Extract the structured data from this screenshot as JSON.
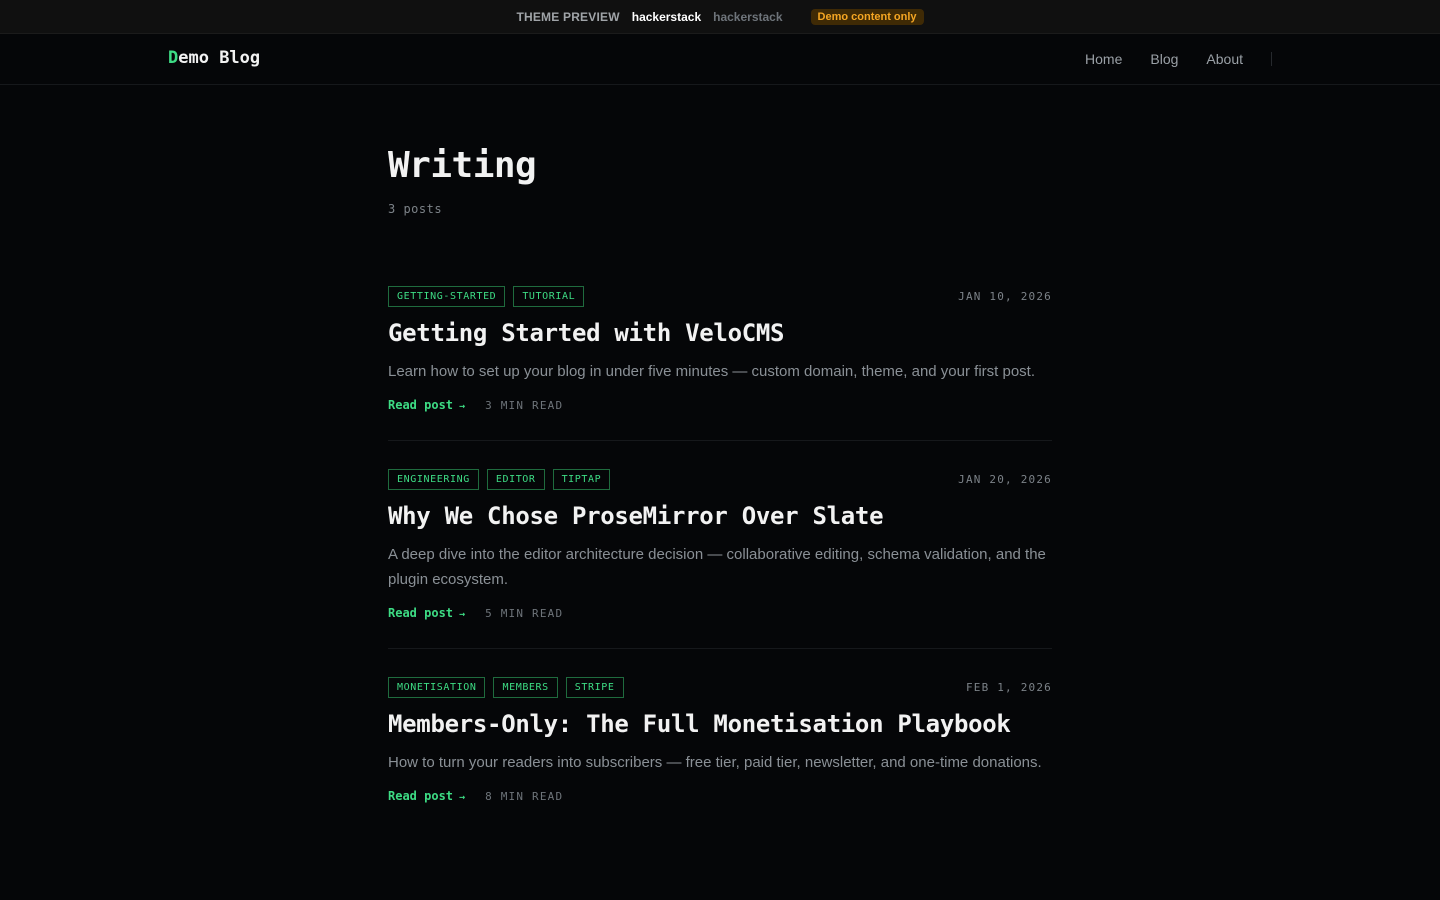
{
  "preview_bar": {
    "label": "THEME PREVIEW",
    "active_theme": "hackerstack",
    "inactive_theme": "hackerstack",
    "badge": "Demo content only"
  },
  "header": {
    "logo_first_letter": "D",
    "logo_rest": "emo Blog",
    "nav": [
      {
        "label": "Home"
      },
      {
        "label": "Blog"
      },
      {
        "label": "About"
      }
    ]
  },
  "page": {
    "title": "Writing",
    "post_count": "3 posts"
  },
  "read_link_label": "Read post",
  "posts": [
    {
      "tags": [
        "GETTING-STARTED",
        "TUTORIAL"
      ],
      "date": "JAN 10, 2026",
      "title": "Getting Started with VeloCMS",
      "excerpt": "Learn how to set up your blog in under five minutes — custom domain, theme, and your first post.",
      "read_time": "3 MIN READ"
    },
    {
      "tags": [
        "ENGINEERING",
        "EDITOR",
        "TIPTAP"
      ],
      "date": "JAN 20, 2026",
      "title": "Why We Chose ProseMirror Over Slate",
      "excerpt": "A deep dive into the editor architecture decision — collaborative editing, schema validation, and the plugin ecosystem.",
      "read_time": "5 MIN READ"
    },
    {
      "tags": [
        "MONETISATION",
        "MEMBERS",
        "STRIPE"
      ],
      "date": "FEB 1, 2026",
      "title": "Members-Only: The Full Monetisation Playbook",
      "excerpt": "How to turn your readers into subscribers — free tier, paid tier, newsletter, and one-time donations.",
      "read_time": "8 MIN READ"
    }
  ],
  "colors": {
    "accent": "#3ddc84",
    "background": "#050608",
    "badge_bg": "#3f2a05",
    "badge_text": "#f5a623"
  }
}
